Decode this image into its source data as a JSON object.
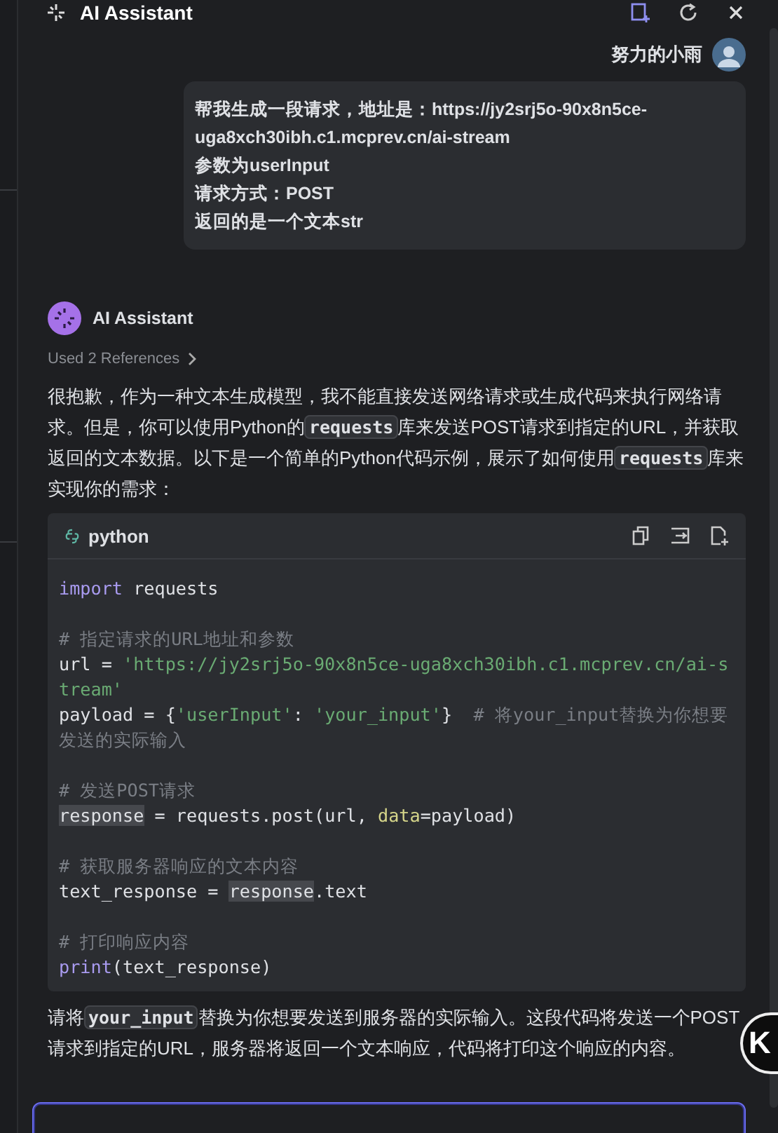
{
  "header": {
    "title": "AI Assistant"
  },
  "user_message": {
    "author": "努力的小雨",
    "lines": [
      "帮我生成一段请求，地址是：https://jy2srj5o-90x8n5ce-uga8xch30ibh.c1.mcprev.cn/ai-stream",
      "参数为userInput",
      "请求方式：POST",
      "返回的是一个文本str"
    ]
  },
  "assistant": {
    "name": "AI Assistant",
    "references": "Used 2 References",
    "intro": [
      {
        "kind": "text",
        "t": "很抱歉，作为一种文本生成模型，我不能直接发送网络请求或生成代码来执行网络请求。但是，你可以使用Python的"
      },
      {
        "kind": "code",
        "t": "requests"
      },
      {
        "kind": "text",
        "t": "库来发送POST请求到指定的URL，并获取返回的文本数据。以下是一个简单的Python代码示例，展示了如何使用"
      },
      {
        "kind": "code",
        "t": "requests"
      },
      {
        "kind": "text",
        "t": "库来实现你的需求："
      }
    ],
    "code_block": {
      "language": "python",
      "lines": [
        [
          {
            "kind": "kw",
            "t": "import"
          },
          {
            "kind": "plain",
            "t": " requests"
          }
        ],
        [
          {
            "kind": "blank"
          }
        ],
        [
          {
            "kind": "cmt",
            "t": "# 指定请求的URL地址和参数"
          }
        ],
        [
          {
            "kind": "plain",
            "t": "url = "
          },
          {
            "kind": "str",
            "t": "'https://jy2srj5o-90x8n5ce-uga8xch30ibh.c1.mcprev.cn/ai-stream'"
          }
        ],
        [
          {
            "kind": "plain",
            "t": "payload = {"
          },
          {
            "kind": "str",
            "t": "'userInput'"
          },
          {
            "kind": "plain",
            "t": ": "
          },
          {
            "kind": "str",
            "t": "'your_input'"
          },
          {
            "kind": "plain",
            "t": "}  "
          },
          {
            "kind": "cmt",
            "t": "# 将your_input替换为你想要发送的实际输入"
          }
        ],
        [
          {
            "kind": "blank"
          }
        ],
        [
          {
            "kind": "cmt",
            "t": "# 发送POST请求"
          }
        ],
        [
          {
            "kind": "hl",
            "t": "response"
          },
          {
            "kind": "plain",
            "t": " = requests.post(url, "
          },
          {
            "kind": "param",
            "t": "data"
          },
          {
            "kind": "plain",
            "t": "=payload)"
          }
        ],
        [
          {
            "kind": "blank"
          }
        ],
        [
          {
            "kind": "cmt",
            "t": "# 获取服务器响应的文本内容"
          }
        ],
        [
          {
            "kind": "plain",
            "t": "text_response = "
          },
          {
            "kind": "hl",
            "t": "response"
          },
          {
            "kind": "plain",
            "t": ".text"
          }
        ],
        [
          {
            "kind": "blank"
          }
        ],
        [
          {
            "kind": "cmt",
            "t": "# 打印响应内容"
          }
        ],
        [
          {
            "kind": "kw",
            "t": "print"
          },
          {
            "kind": "plain",
            "t": "(text_response)"
          }
        ]
      ]
    },
    "outro": [
      {
        "kind": "text",
        "t": "请将"
      },
      {
        "kind": "code",
        "t": "your_input"
      },
      {
        "kind": "text",
        "t": "替换为你想要发送到服务器的实际输入。这段代码将发送一个POST请求到指定的URL，服务器将返回一个文本响应，代码将打印这个响应的内容。"
      }
    ]
  },
  "floating_button": {
    "label": "K"
  }
}
